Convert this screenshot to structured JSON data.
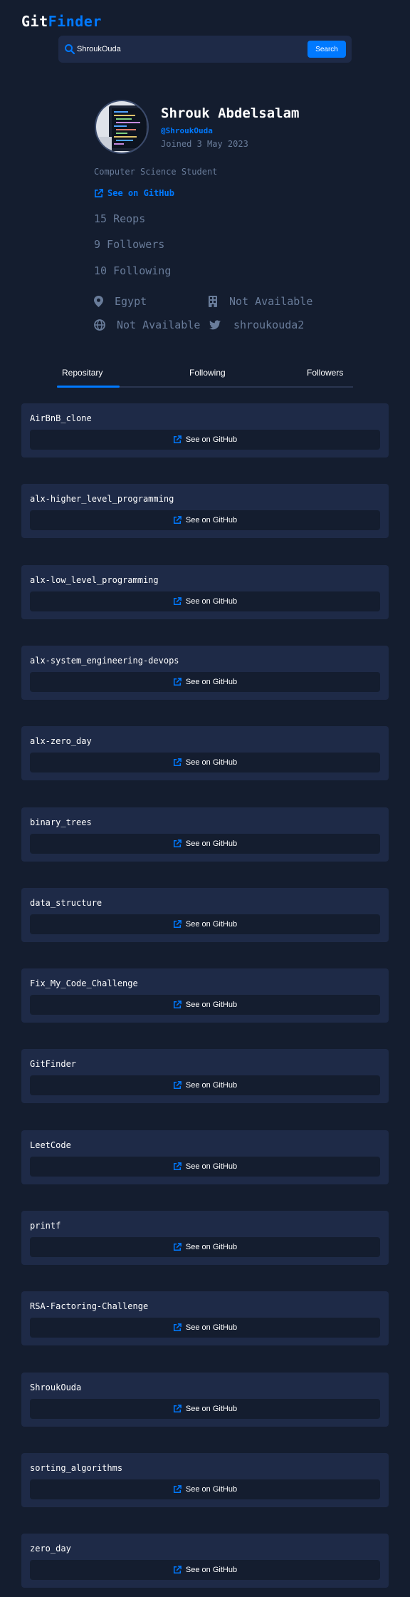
{
  "logo": {
    "part1": "Git",
    "part2": "Finder"
  },
  "search": {
    "value": "ShroukOuda",
    "button_label": "Search"
  },
  "profile": {
    "name": "Shrouk Abdelsalam",
    "handle": "@ShroukOuda",
    "joined": "Joined 3 May 2023",
    "bio": "Computer Science Student",
    "github_link": "See on GitHub",
    "repos": "15 Reops",
    "followers": "9 Followers",
    "following": "10 Following",
    "location": "Egypt",
    "company": "Not Available",
    "website": "Not Available",
    "twitter": "shroukouda2"
  },
  "tabs": {
    "repository": "Repositary",
    "following": "Following",
    "followers": "Followers"
  },
  "repo_button_label": "See on GitHub",
  "repos": [
    "AirBnB_clone",
    "alx-higher_level_programming",
    "alx-low_level_programming",
    "alx-system_engineering-devops",
    "alx-zero_day",
    "binary_trees",
    "data_structure",
    "Fix_My_Code_Challenge",
    "GitFinder",
    "LeetCode",
    "printf",
    "RSA-Factoring-Challenge",
    "ShroukOuda",
    "sorting_algorithms",
    "zero_day"
  ],
  "colors": {
    "accent": "#0079ff",
    "background": "#141d2f",
    "card": "#1e2a47",
    "muted": "#697c9a"
  }
}
